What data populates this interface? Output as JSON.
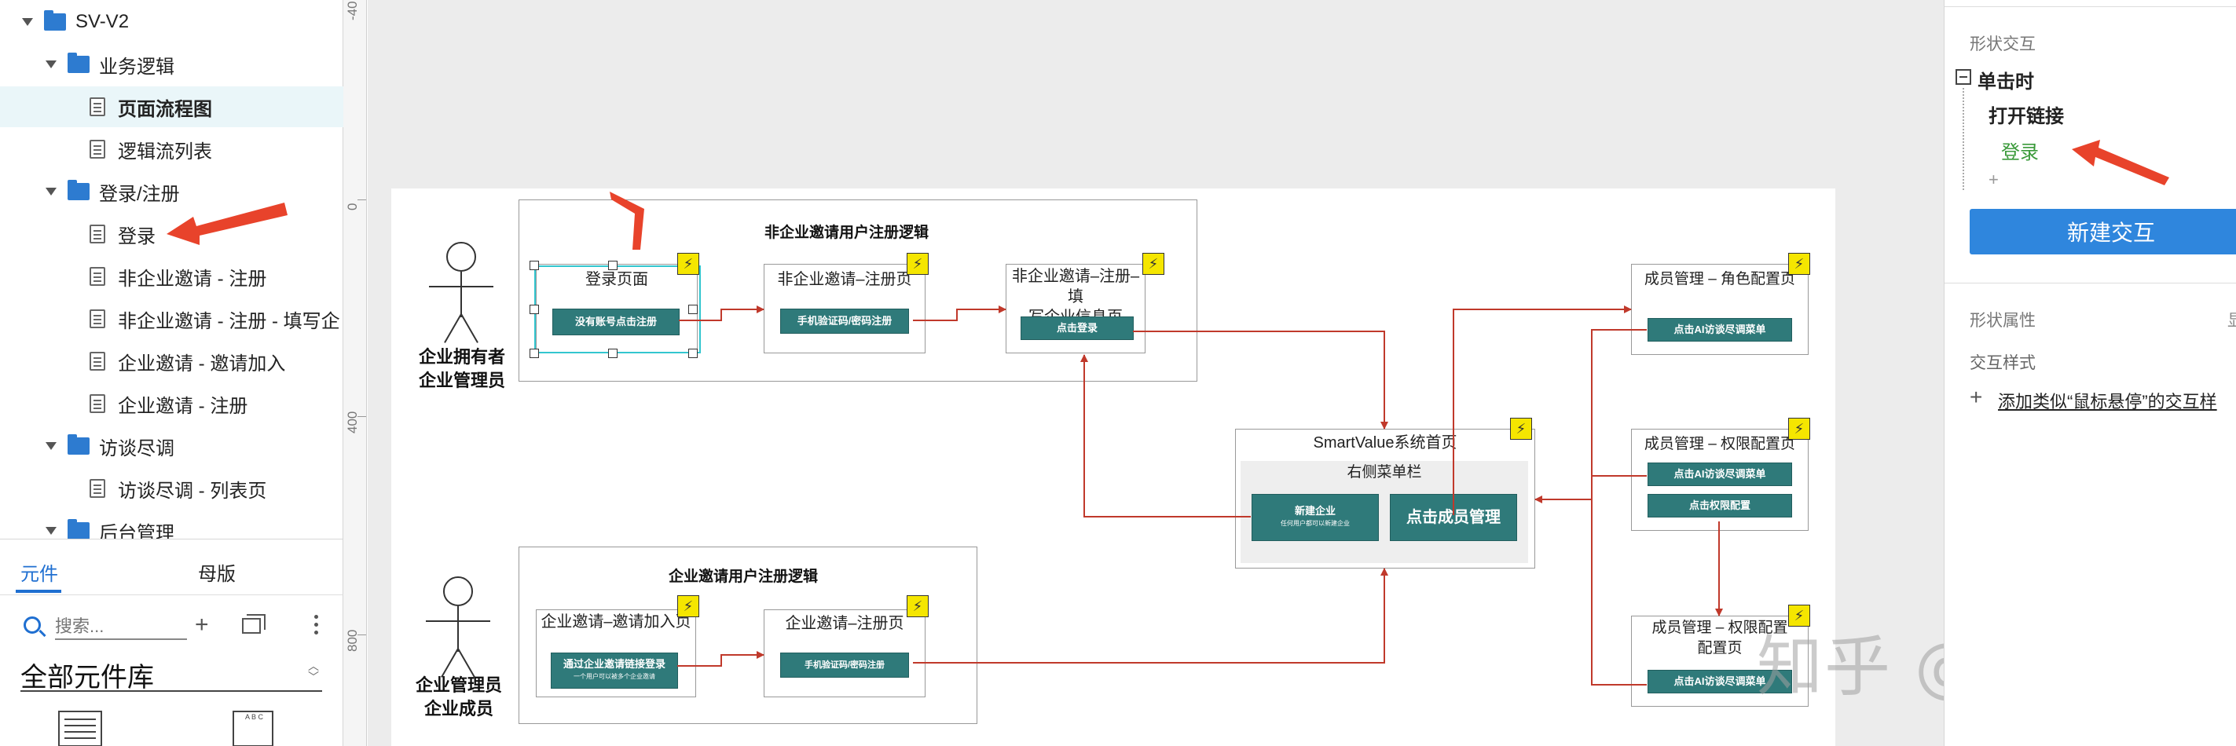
{
  "page_tree": {
    "items": [
      {
        "label": "SV-V2",
        "type": "folder",
        "level": 0
      },
      {
        "label": "业务逻辑",
        "type": "folder",
        "level": 1
      },
      {
        "label": "页面流程图",
        "type": "page",
        "level": 2
      },
      {
        "label": "逻辑流列表",
        "type": "page",
        "level": 2
      },
      {
        "label": "登录/注册",
        "type": "folder",
        "level": 1
      },
      {
        "label": "登录",
        "type": "page",
        "level": 2
      },
      {
        "label": "非企业邀请 - 注册",
        "type": "page",
        "level": 2
      },
      {
        "label": "非企业邀请 - 注册 - 填写企",
        "type": "page",
        "level": 2
      },
      {
        "label": "企业邀请 - 邀请加入",
        "type": "page",
        "level": 2
      },
      {
        "label": "企业邀请 - 注册",
        "type": "page",
        "level": 2
      },
      {
        "label": "访谈尽调",
        "type": "folder",
        "level": 1
      },
      {
        "label": "访谈尽调 - 列表页",
        "type": "page",
        "level": 2
      },
      {
        "label": "后台管理",
        "type": "folder",
        "level": 1
      }
    ]
  },
  "library": {
    "tab_components": "元件",
    "tab_masters": "母版",
    "search_placeholder": "搜索...",
    "add_icon": "plus-icon",
    "library_name": "全部元件库",
    "widget_b_text": "A B C"
  },
  "ruler": {
    "labels": [
      "-40",
      "0",
      "400",
      "800"
    ]
  },
  "diagram": {
    "actor1_label_line1": "企业拥有者",
    "actor1_label_line2": "企业管理员",
    "actor2_label_line1": "企业管理员",
    "actor2_label_line2": "企业成员",
    "group1_title": "非企业邀请用户注册逻辑",
    "group2_title": "企业邀请用户注册逻辑",
    "login_page_title": "登录页面",
    "login_page_btn": "没有账号点击注册",
    "register_page_title": "非企业邀请–注册页",
    "register_page_btn": "手机验证码/密码注册",
    "fill_info_title_line1": "非企业邀请–注册–填",
    "fill_info_title_line2": "写企业信息页",
    "fill_info_btn": "点击登录",
    "home_title": "SmartValue系统首页",
    "home_menu_title": "右侧菜单栏",
    "home_new_company": "新建企业",
    "home_new_company_sub": "任何用户都可以新建企业",
    "home_member_mgmt": "点击成员管理",
    "role_config_title": "成员管理 – 角色配置页",
    "role_config_btn": "点击AI访谈尽调菜单",
    "perm_config_title": "成员管理 – 权限配置页",
    "perm_config_btn1": "点击AI访谈尽调菜单",
    "perm_config_btn2": "点击权限配置",
    "perm_config2_title_line1": "成员管理 – 权限配置",
    "perm_config2_title_line2": "配置页",
    "perm_config2_btn": "点击AI访谈尽调菜单",
    "invite_join_title": "企业邀请–邀请加入页",
    "invite_join_btn": "通过企业邀请链接登录",
    "invite_join_btn_sub": "一个用户可以被多个企业邀请",
    "invite_register_title": "企业邀请–注册页",
    "invite_register_btn": "手机验证码/密码注册",
    "bolt_symbol": "⚡"
  },
  "watermark": "知乎 @咚咚锵",
  "right_panel": {
    "section_interactions": "形状交互",
    "event_label": "单击时",
    "action_label": "打开链接",
    "target_label": "登录",
    "add_symbol": "+",
    "new_interaction_btn": "新建交互",
    "section_shape_props": "形状属性",
    "shape_props_extra": "显",
    "section_interaction_style": "交互样式",
    "add_hover_style": "添加类似“鼠标悬停”的交互样",
    "add_hover_plus": "+"
  },
  "colors": {
    "accent_blue": "#2f86dd",
    "folder_blue": "#2d7bd0",
    "teal_button": "#2f7a7a",
    "connector_red": "#c0392b",
    "annotation_arrow": "#e8432b",
    "bolt_yellow": "#f5e600",
    "selection_cyan": "#33c6cf",
    "target_green": "#3a9a3a"
  }
}
